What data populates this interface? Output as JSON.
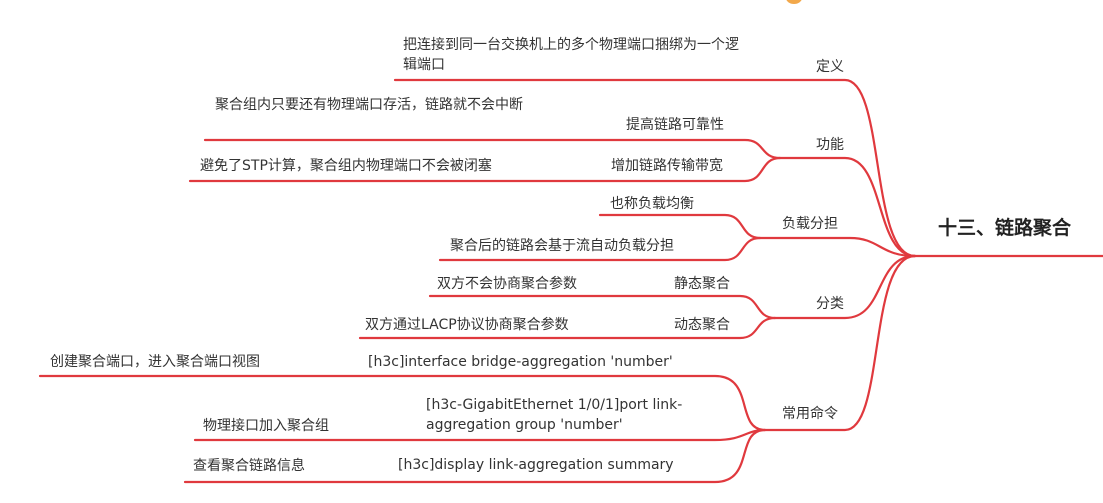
{
  "root": "十三、链路聚合",
  "branches": {
    "definition": {
      "label": "定义",
      "leaf": "把连接到同一台交换机上的多个物理端口捆绑为一个逻辑端口"
    },
    "function": {
      "label": "功能",
      "reliability": {
        "label": "提高链路可靠性",
        "leaf": "聚合组内只要还有物理端口存活，链路就不会中断"
      },
      "bandwidth": {
        "label": "增加链路传输带宽",
        "leaf": "避免了STP计算，聚合组内物理端口不会被闭塞"
      }
    },
    "load": {
      "label": "负载分担",
      "items": [
        "也称负载均衡",
        "聚合后的链路会基于流自动负载分担"
      ]
    },
    "category": {
      "label": "分类",
      "static": {
        "label": "静态聚合",
        "leaf": "双方不会协商聚合参数"
      },
      "dynamic": {
        "label": "动态聚合",
        "leaf": "双方通过LACP协议协商聚合参数"
      }
    },
    "commands": {
      "label": "常用命令",
      "cmd1": {
        "label": "[h3c]interface bridge-aggregation 'number'",
        "leaf": "创建聚合端口，进入聚合端口视图"
      },
      "cmd2": {
        "label": "[h3c-GigabitEthernet 1/0/1]port link-aggregation group 'number'",
        "leaf": "物理接口加入聚合组"
      },
      "cmd3": {
        "label": "[h3c]display link-aggregation summary",
        "leaf": "查看聚合链路信息"
      }
    }
  },
  "colors": {
    "line": "#e0393e",
    "text": "#333333",
    "root_text": "#222222",
    "accent": "#f2a84b"
  }
}
